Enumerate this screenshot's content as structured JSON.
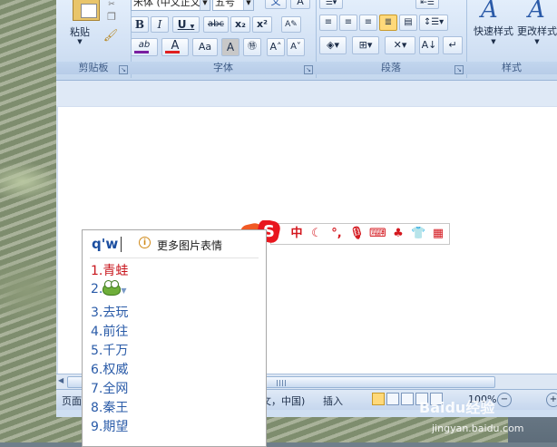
{
  "ribbon": {
    "clipboard": {
      "paste_label": "粘贴",
      "group_label": "剪贴板"
    },
    "font": {
      "font_name": "宋体 (中文正文)",
      "font_size": "五号",
      "group_label": "字体",
      "bold": "B",
      "italic": "I",
      "underline": "U",
      "strike": "abc",
      "sub": "x₂",
      "sup": "x²",
      "change_case": "Aa",
      "char_shade": "A",
      "enclose": "字",
      "grow": "A˄",
      "shrink": "A˅",
      "highlight": "ab",
      "font_color": "A"
    },
    "paragraph": {
      "group_label": "段落"
    },
    "styles": {
      "quick_styles": "快速样式",
      "change_styles": "更改样式",
      "group_label": "样式"
    }
  },
  "ime": {
    "pinyin": "q'w",
    "more_images": "更多图片表情",
    "candidates": [
      {
        "num": "1.",
        "text": "青蛙"
      },
      {
        "num": "2.",
        "text": ""
      },
      {
        "num": "3.",
        "text": "去玩"
      },
      {
        "num": "4.",
        "text": "前往"
      },
      {
        "num": "5.",
        "text": "千万"
      },
      {
        "num": "6.",
        "text": "权威"
      },
      {
        "num": "7.",
        "text": "全网"
      },
      {
        "num": "8.",
        "text": "秦王"
      },
      {
        "num": "9.",
        "text": "期望"
      }
    ],
    "toolbar_zh": "中"
  },
  "statusbar": {
    "page": "页面",
    "lang": "文，中国)",
    "insert": "插入",
    "zoom": "100%"
  },
  "watermark": {
    "brand": "Baidu经验",
    "url": "jingyan.baidu.com"
  },
  "colors": {
    "highlight": "#f2e33a",
    "font_color": "#e02020",
    "sogou_red": "#d4171e",
    "candidate_blue": "#2a5ba8",
    "candidate_selected": "#c8161d"
  }
}
